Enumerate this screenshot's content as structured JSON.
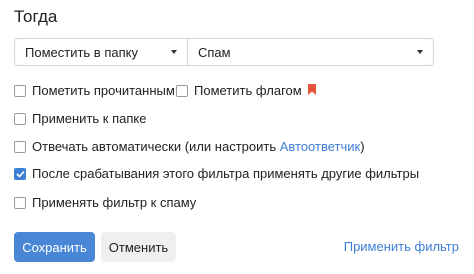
{
  "section": {
    "title": "Тогда"
  },
  "action_select": {
    "value": "Поместить в папку"
  },
  "folder_select": {
    "value": "Спам"
  },
  "options": {
    "mark_read": {
      "label": "Пометить прочитанным",
      "checked": false
    },
    "mark_flag": {
      "label": "Пометить флагом",
      "checked": false,
      "flag_color": "#e5533d"
    },
    "apply_to_folder": {
      "label": "Применить к папке",
      "checked": false
    },
    "auto_reply": {
      "label": "Отвечать автоматически (или настроить ",
      "link": "Автоответчик",
      "suffix": ")",
      "checked": false
    },
    "continue_filters": {
      "label": "После срабатывания этого фильтра применять другие фильтры",
      "checked": true
    },
    "apply_to_spam": {
      "label": "Применять фильтр к спаму",
      "checked": false
    }
  },
  "buttons": {
    "save": "Сохранить",
    "cancel": "Отменить",
    "apply_filter": "Применить фильтр"
  },
  "colors": {
    "accent": "#3d7fd6",
    "primary_button": "#4a86d6"
  }
}
